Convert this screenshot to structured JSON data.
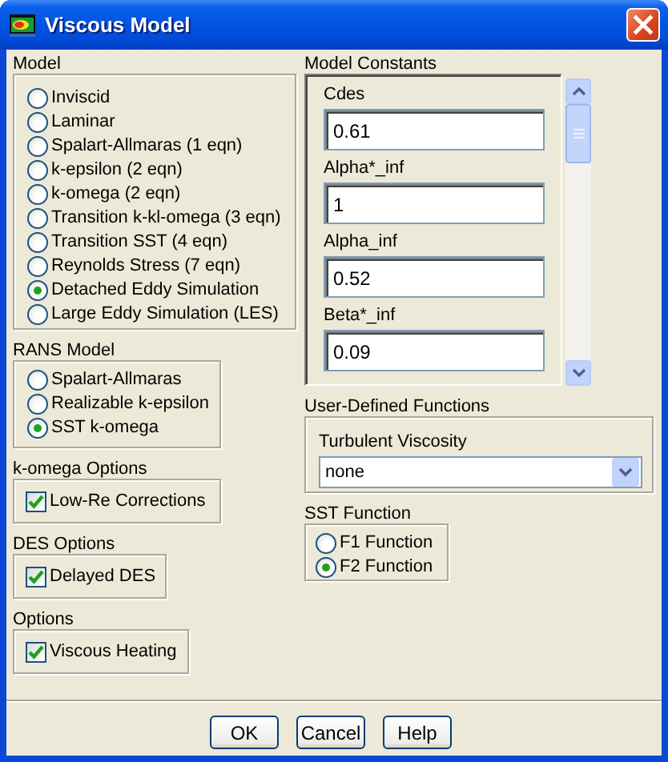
{
  "window": {
    "title": "Viscous Model"
  },
  "model": {
    "label": "Model",
    "options": [
      {
        "label": "Inviscid",
        "selected": false
      },
      {
        "label": "Laminar",
        "selected": false
      },
      {
        "label": "Spalart-Allmaras (1 eqn)",
        "selected": false
      },
      {
        "label": "k-epsilon (2 eqn)",
        "selected": false
      },
      {
        "label": "k-omega (2 eqn)",
        "selected": false
      },
      {
        "label": "Transition k-kl-omega (3 eqn)",
        "selected": false
      },
      {
        "label": "Transition SST (4 eqn)",
        "selected": false
      },
      {
        "label": "Reynolds Stress (7 eqn)",
        "selected": false
      },
      {
        "label": "Detached Eddy Simulation",
        "selected": true
      },
      {
        "label": "Large Eddy Simulation (LES)",
        "selected": false
      }
    ]
  },
  "rans_model": {
    "label": "RANS Model",
    "options": [
      {
        "label": "Spalart-Allmaras",
        "selected": false
      },
      {
        "label": "Realizable k-epsilon",
        "selected": false
      },
      {
        "label": "SST k-omega",
        "selected": true
      }
    ]
  },
  "k_omega_options": {
    "label": "k-omega Options",
    "options": [
      {
        "label": "Low-Re Corrections",
        "checked": true
      }
    ]
  },
  "des_options": {
    "label": "DES Options",
    "options": [
      {
        "label": "Delayed DES",
        "checked": true
      }
    ]
  },
  "options": {
    "label": "Options",
    "options": [
      {
        "label": "Viscous Heating",
        "checked": true
      }
    ]
  },
  "model_constants": {
    "label": "Model Constants",
    "fields": [
      {
        "label": "Cdes",
        "value": "0.61"
      },
      {
        "label": "Alpha*_inf",
        "value": "1"
      },
      {
        "label": "Alpha_inf",
        "value": "0.52"
      },
      {
        "label": "Beta*_inf",
        "value": "0.09"
      }
    ]
  },
  "user_defined_functions": {
    "label": "User-Defined Functions",
    "fields": [
      {
        "label": "Turbulent Viscosity",
        "value": "none"
      }
    ]
  },
  "sst_function": {
    "label": "SST Function",
    "options": [
      {
        "label": "F1 Function",
        "selected": false
      },
      {
        "label": "F2 Function",
        "selected": true
      }
    ]
  },
  "buttons": [
    "OK",
    "Cancel",
    "Help"
  ]
}
